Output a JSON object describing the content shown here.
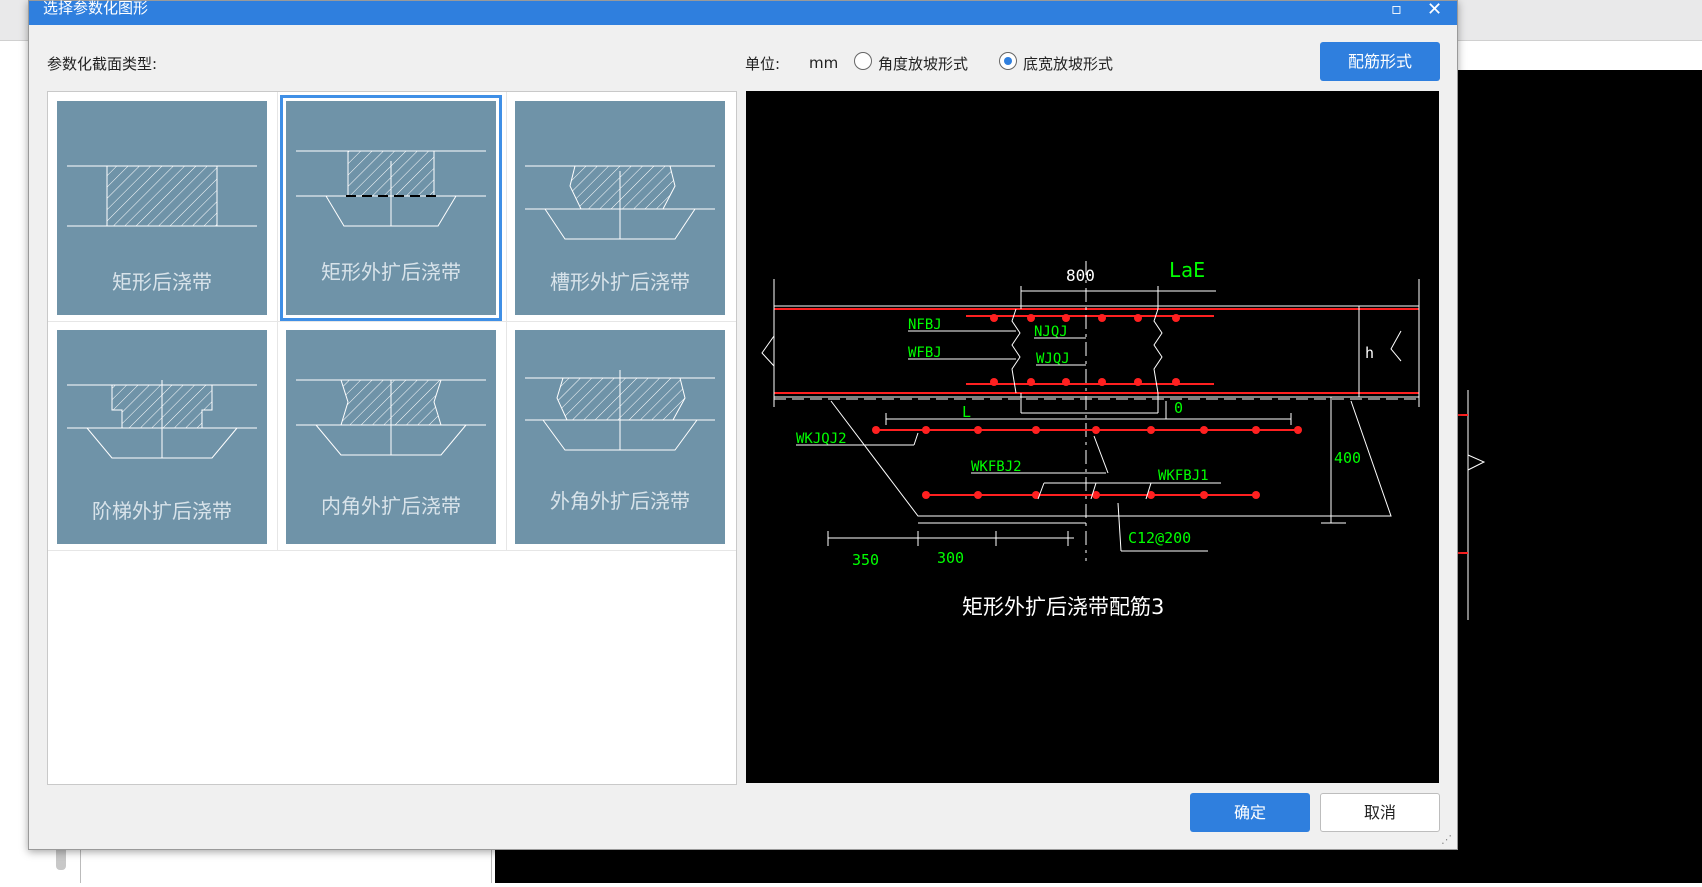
{
  "dialog": {
    "title": "选择参数化图形",
    "section_type_label": "参数化截面类型:",
    "unit_label": "单位:",
    "unit_value": "mm",
    "radio_angle": "角度放坡形式",
    "radio_width": "底宽放坡形式",
    "selected_radio": "width",
    "rebar_button": "配筋形式",
    "ok_button": "确定",
    "cancel_button": "取消"
  },
  "thumbnails": [
    {
      "name": "矩形后浇带",
      "selected": false
    },
    {
      "name": "矩形外扩后浇带",
      "selected": true
    },
    {
      "name": "槽形外扩后浇带",
      "selected": false
    },
    {
      "name": "阶梯外扩后浇带",
      "selected": false
    },
    {
      "name": "内角外扩后浇带",
      "selected": false
    },
    {
      "name": "外角外扩后浇带",
      "selected": false
    }
  ],
  "preview": {
    "caption": "矩形外扩后浇带配筋3",
    "dim_top": "800",
    "lae": "LaE",
    "labels": {
      "nfbj": "NFBJ",
      "wfbj": "WFBJ",
      "njqj": "NJQJ",
      "wjqj": "WJQJ",
      "h": "h",
      "l": "L",
      "zero": "0",
      "wkjqj2": "WKJQJ2",
      "wkfbj2": "WKFBJ2",
      "wkfbj1": "WKFBJ1",
      "d400": "400",
      "c12": "C12@200",
      "d350": "350",
      "d300": "300"
    }
  },
  "colors": {
    "titlebar": "#2f7fde",
    "thumb_bg": "#6f93a8",
    "rebar": "#ff2020",
    "label_green": "#00ff00"
  }
}
